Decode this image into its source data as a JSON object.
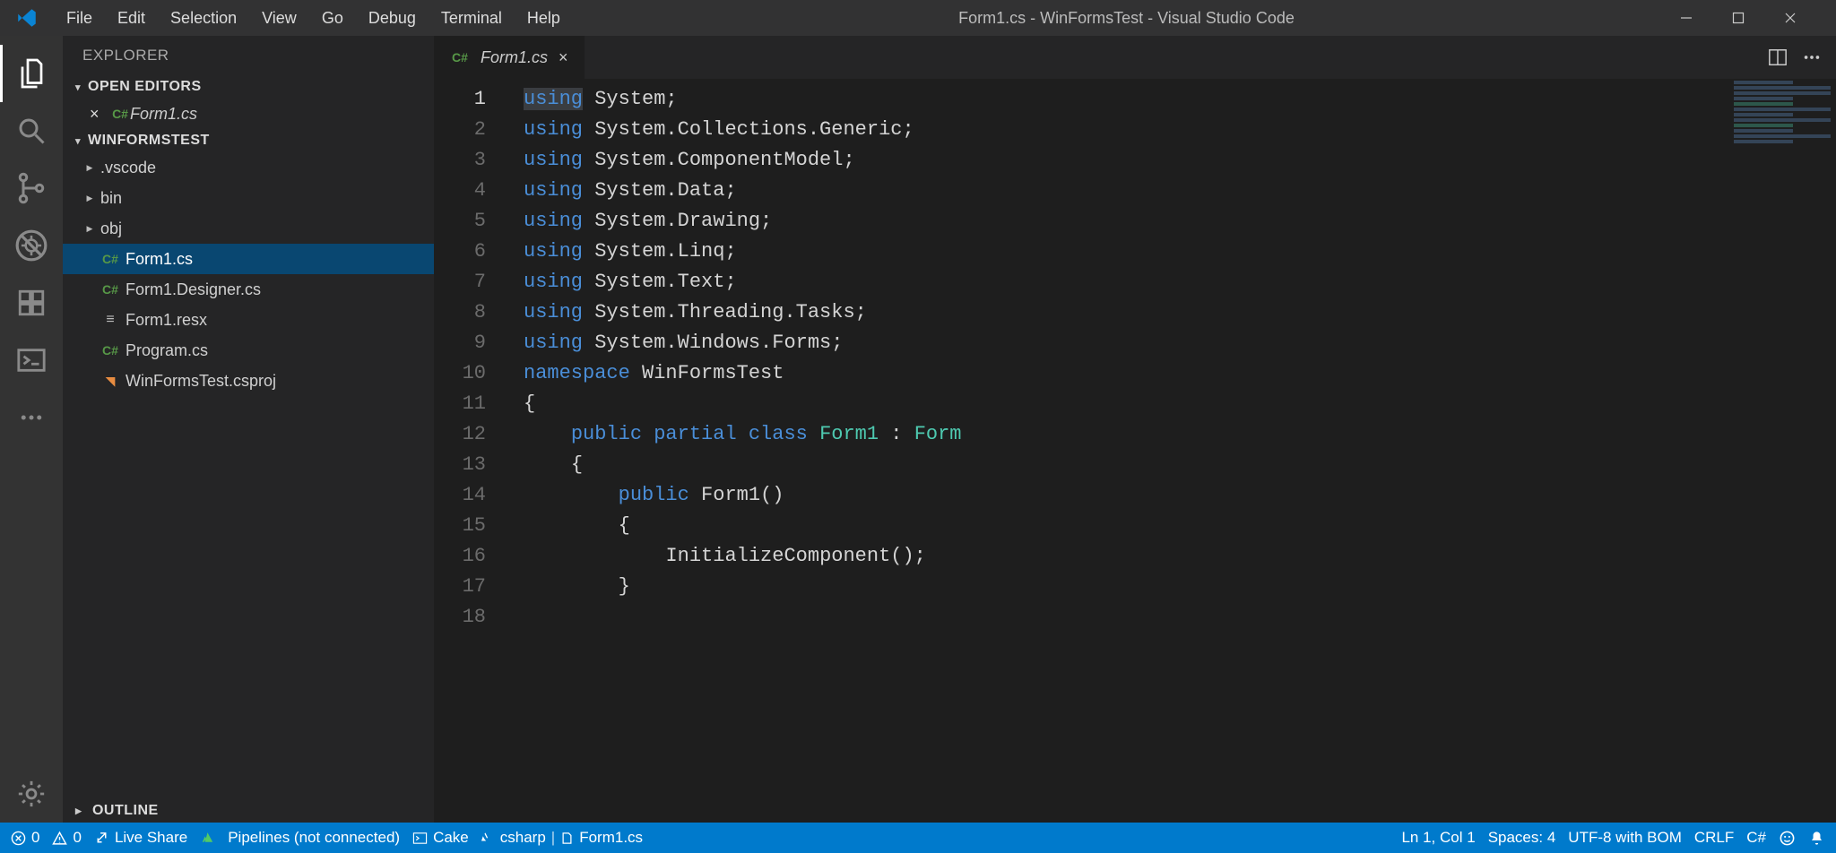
{
  "window": {
    "title": "Form1.cs - WinFormsTest - Visual Studio Code"
  },
  "menubar": [
    "File",
    "Edit",
    "Selection",
    "View",
    "Go",
    "Debug",
    "Terminal",
    "Help"
  ],
  "sidebar": {
    "title": "EXPLORER",
    "sections": {
      "open_editors": "Open Editors",
      "project": "WinFormsTest",
      "outline": "Outline"
    },
    "open_file": "Form1.cs",
    "files": {
      "vscode": ".vscode",
      "bin": "bin",
      "obj": "obj",
      "form1": "Form1.cs",
      "form1designer": "Form1.Designer.cs",
      "form1resx": "Form1.resx",
      "program": "Program.cs",
      "csproj": "WinFormsTest.csproj"
    }
  },
  "tab": {
    "filename": "Form1.cs"
  },
  "code": {
    "lines": [
      [
        [
          "kw-bg",
          "using"
        ],
        [
          "txt",
          " "
        ],
        [
          "txt",
          "System;"
        ]
      ],
      [
        [
          "kw",
          "using"
        ],
        [
          "txt",
          " "
        ],
        [
          "txt",
          "System.Collections.Generic;"
        ]
      ],
      [
        [
          "kw",
          "using"
        ],
        [
          "txt",
          " "
        ],
        [
          "txt",
          "System.ComponentModel;"
        ]
      ],
      [
        [
          "kw",
          "using"
        ],
        [
          "txt",
          " "
        ],
        [
          "txt",
          "System.Data;"
        ]
      ],
      [
        [
          "kw",
          "using"
        ],
        [
          "txt",
          " "
        ],
        [
          "txt",
          "System.Drawing;"
        ]
      ],
      [
        [
          "kw",
          "using"
        ],
        [
          "txt",
          " "
        ],
        [
          "txt",
          "System.Linq;"
        ]
      ],
      [
        [
          "kw",
          "using"
        ],
        [
          "txt",
          " "
        ],
        [
          "txt",
          "System.Text;"
        ]
      ],
      [
        [
          "kw",
          "using"
        ],
        [
          "txt",
          " "
        ],
        [
          "txt",
          "System.Threading.Tasks;"
        ]
      ],
      [
        [
          "kw",
          "using"
        ],
        [
          "txt",
          " "
        ],
        [
          "txt",
          "System.Windows.Forms;"
        ]
      ],
      [
        [
          "txt",
          ""
        ]
      ],
      [
        [
          "kw",
          "namespace"
        ],
        [
          "txt",
          " "
        ],
        [
          "txt",
          "WinFormsTest"
        ]
      ],
      [
        [
          "txt",
          "{"
        ]
      ],
      [
        [
          "guide",
          "    "
        ],
        [
          "kw",
          "public"
        ],
        [
          "txt",
          " "
        ],
        [
          "kw",
          "partial"
        ],
        [
          "txt",
          " "
        ],
        [
          "kw",
          "class"
        ],
        [
          "txt",
          " "
        ],
        [
          "type",
          "Form1"
        ],
        [
          "txt",
          " : "
        ],
        [
          "type",
          "Form"
        ]
      ],
      [
        [
          "guide",
          "    "
        ],
        [
          "txt",
          "{"
        ]
      ],
      [
        [
          "guide",
          "        "
        ],
        [
          "kw",
          "public"
        ],
        [
          "txt",
          " "
        ],
        [
          "txt",
          "Form1()"
        ]
      ],
      [
        [
          "guide",
          "        "
        ],
        [
          "txt",
          "{"
        ]
      ],
      [
        [
          "guide",
          "            "
        ],
        [
          "txt",
          "InitializeComponent();"
        ]
      ],
      [
        [
          "guide",
          "        "
        ],
        [
          "txt",
          "}"
        ]
      ]
    ]
  },
  "status": {
    "errors": "0",
    "warnings": "0",
    "liveshare": "Live Share",
    "pipelines": "Pipelines (not connected)",
    "cake": "Cake",
    "csharp": "csharp",
    "docfile": "Form1.cs",
    "position": "Ln 1, Col 1",
    "spaces": "Spaces: 4",
    "encoding": "UTF-8 with BOM",
    "eol": "CRLF",
    "language": "C#"
  }
}
